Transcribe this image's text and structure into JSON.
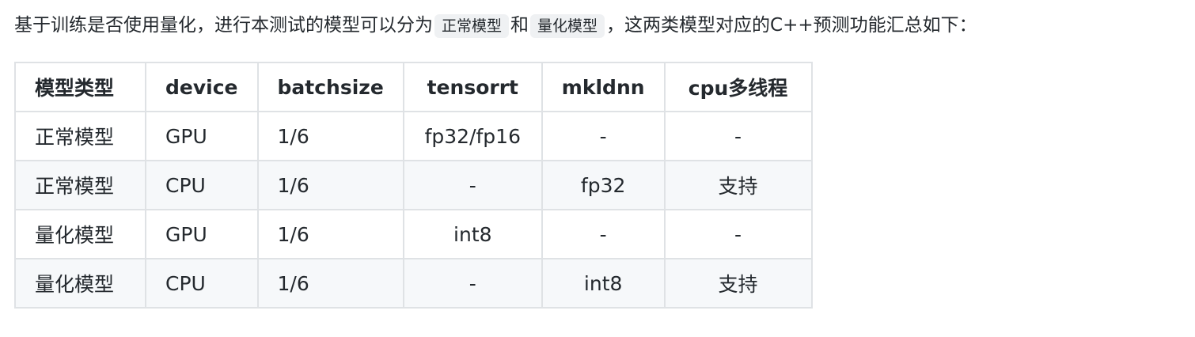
{
  "intro": {
    "before": "基于训练是否使用量化，进行本测试的模型可以分为",
    "code1": "正常模型",
    "middle": "和",
    "code2": "量化模型",
    "after": "，这两类模型对应的C++预测功能汇总如下："
  },
  "table": {
    "headers": [
      "模型类型",
      "device",
      "batchsize",
      "tensorrt",
      "mkldnn",
      "cpu多线程"
    ],
    "rows": [
      [
        "正常模型",
        "GPU",
        "1/6",
        "fp32/fp16",
        "-",
        "-"
      ],
      [
        "正常模型",
        "CPU",
        "1/6",
        "-",
        "fp32",
        "支持"
      ],
      [
        "量化模型",
        "GPU",
        "1/6",
        "int8",
        "-",
        "-"
      ],
      [
        "量化模型",
        "CPU",
        "1/6",
        "-",
        "int8",
        "支持"
      ]
    ]
  }
}
